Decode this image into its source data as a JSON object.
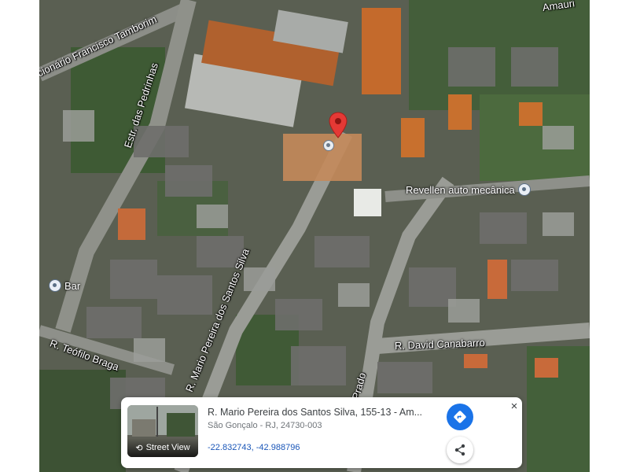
{
  "map": {
    "streets": {
      "francisco_tamborim": "cionário Francisco Tamborim",
      "amauri": "Amauri",
      "pedrinhas": "Estr. das Pedrinhas",
      "mario_pereira": "R. Mario Pereira dos Santos Silva",
      "teofilo_braga": "R. Teófilo Braga",
      "david_canabarro": "R. David Canabarro",
      "prado": "Prado"
    },
    "pois": {
      "revellen": "Revellen auto mecânica",
      "bar": "Bar"
    },
    "selected_pin_icon": "red-location-pin-icon"
  },
  "card": {
    "street_view_label": "Street View",
    "address": "R. Mario Pereira dos Santos Silva, 155-13 - Am...",
    "city": "São Gonçalo - RJ, 24730-003",
    "coordinates": "-22.832743, -42.988796",
    "close_label": "×",
    "accent_color": "#1a73e8"
  }
}
